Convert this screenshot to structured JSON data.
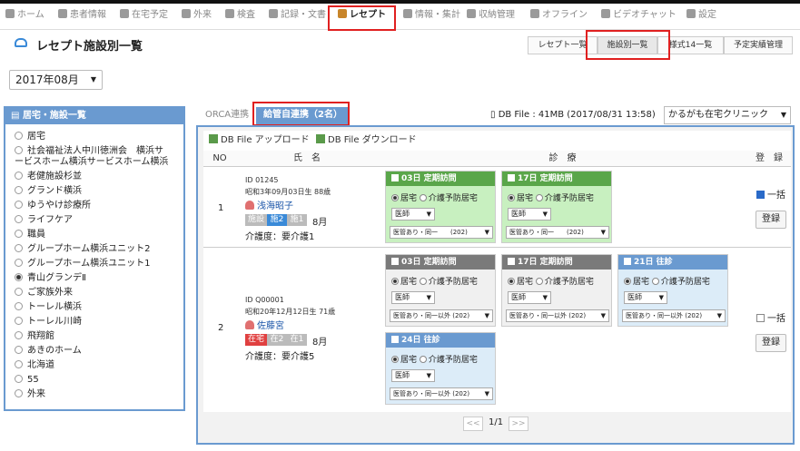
{
  "nav": [
    {
      "label": "ホーム",
      "icon": "home-icon"
    },
    {
      "label": "患者情報",
      "icon": "patient-icon"
    },
    {
      "label": "在宅予定",
      "icon": "clock-icon"
    },
    {
      "label": "外来",
      "icon": "outpatient-icon"
    },
    {
      "label": "検査",
      "icon": "chart-icon"
    },
    {
      "label": "記録・文書",
      "icon": "document-icon"
    },
    {
      "label": "レセプト",
      "icon": "folder-icon"
    },
    {
      "label": "情報・集計",
      "icon": "stats-icon"
    },
    {
      "label": "収納管理",
      "icon": "register-icon"
    },
    {
      "label": "オフライン",
      "icon": "plug-icon"
    },
    {
      "label": "ビデオチャット",
      "icon": "video-icon"
    },
    {
      "label": "設定",
      "icon": "gear-icon"
    }
  ],
  "page_title": "レセプト施設別一覧",
  "top_buttons": [
    "レセプト一覧",
    "施設別一覧",
    "様式14一覧",
    "予定実績管理"
  ],
  "month": "2017年08月",
  "sidebar": {
    "title": "居宅・施設一覧",
    "items": [
      "居宅",
      "社会福祉法人中川徳洲会　横浜サ",
      "ービスホーム横浜サービスホーム横浜",
      "老健施設杉並",
      "グランド横浜",
      "ゆうやけ診療所",
      "ライフケア",
      "職員",
      "グループホーム横浜ユニット2",
      "グループホーム横浜ユニット1",
      "青山グランデⅡ",
      "ご家族外来",
      "トーレル横浜",
      "トーレル川崎",
      "飛翔館",
      "あきのホーム",
      "北海道",
      "55",
      "外来"
    ]
  },
  "tabs": {
    "orca": "ORCA連携",
    "link": "給管自連携（2名）"
  },
  "db_info": "DB File : 41MB (2017/08/31 13:58)",
  "clinic": "かるがも在宅クリニック",
  "file_buttons": {
    "upload": "DB File アップロード",
    "download": "DB File ダウンロード"
  },
  "table_headers": {
    "no": "NO",
    "name": "氏　名",
    "care": "診　療",
    "register": "登　録"
  },
  "patients": [
    {
      "no": "1",
      "id": "ID 01245",
      "dob": "昭和3年09月03日生 88歳",
      "name": "浅海昭子",
      "badges": [
        "施設",
        "施2",
        "施1"
      ],
      "month": "8月",
      "care_level": "介護度：要介護1",
      "cards": [
        {
          "title": "03日 定期訪問",
          "opt1": "居宅",
          "opt2": "介護予防居宅",
          "doctor": "医師",
          "fee": "医管あり・同一　　(202)"
        },
        {
          "title": "17日 定期訪問",
          "opt1": "居宅",
          "opt2": "介護予防居宅",
          "doctor": "医師",
          "fee": "医管あり・同一　　(202)"
        }
      ],
      "all_label": "一括",
      "register": "登録"
    },
    {
      "no": "2",
      "id": "ID Q00001",
      "dob": "昭和20年12月12日生 71歳",
      "name": "佐藤宮",
      "badges": [
        "在宅",
        "在2",
        "在1"
      ],
      "month": "8月",
      "care_level": "介護度：要介護5",
      "cards": [
        {
          "title": "03日 定期訪問",
          "opt1": "居宅",
          "opt2": "介護予防居宅",
          "doctor": "医師",
          "fee": "医管あり・同一以外 (202)"
        },
        {
          "title": "17日 定期訪問",
          "opt1": "居宅",
          "opt2": "介護予防居宅",
          "doctor": "医師",
          "fee": "医管あり・同一以外 (202)"
        },
        {
          "title": "21日 往診",
          "opt1": "居宅",
          "opt2": "介護予防居宅",
          "doctor": "医師",
          "fee": "医管あり・同一以外 (202)"
        },
        {
          "title": "24日 往診",
          "opt1": "居宅",
          "opt2": "介護予防居宅",
          "doctor": "医師",
          "fee": "医管あり・同一以外 (202)"
        }
      ],
      "all_label": "一括",
      "register": "登録"
    }
  ],
  "pagination": {
    "prev": "<<",
    "page": "1/1",
    "next": ">>"
  }
}
